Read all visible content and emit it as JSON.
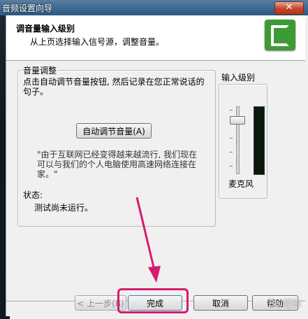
{
  "window": {
    "title": "音频设置向导",
    "close_glyph": "✕"
  },
  "header": {
    "title": "调音量输入级别",
    "subtitle": "从上页选择输入信号源，调整音量。",
    "logo_icon": "camtasia-logo-icon",
    "logo_color": "#3d9b35"
  },
  "volume_group": {
    "label": "音量调整",
    "instruction": "点击自动调节音量按钮, 然后记录在您正常说话的句子。",
    "auto_button": "自动调节音量(A)",
    "quote": "\"由于互联网已经变得越来越流行, 我们现在可以与我们的个人电脑使用高速网络连接在家。\"",
    "status_label": "状态:",
    "status_value": "测试尚未运行。"
  },
  "level_group": {
    "label": "输入级别",
    "meter_label": "麦克风",
    "slider_level": 0.85
  },
  "footer": {
    "back": "< 上一步(B)",
    "finish": "完成",
    "cancel": "取消",
    "help": "帮助"
  },
  "watermark": "Bai经验",
  "annotation_color": "#d81b6c"
}
